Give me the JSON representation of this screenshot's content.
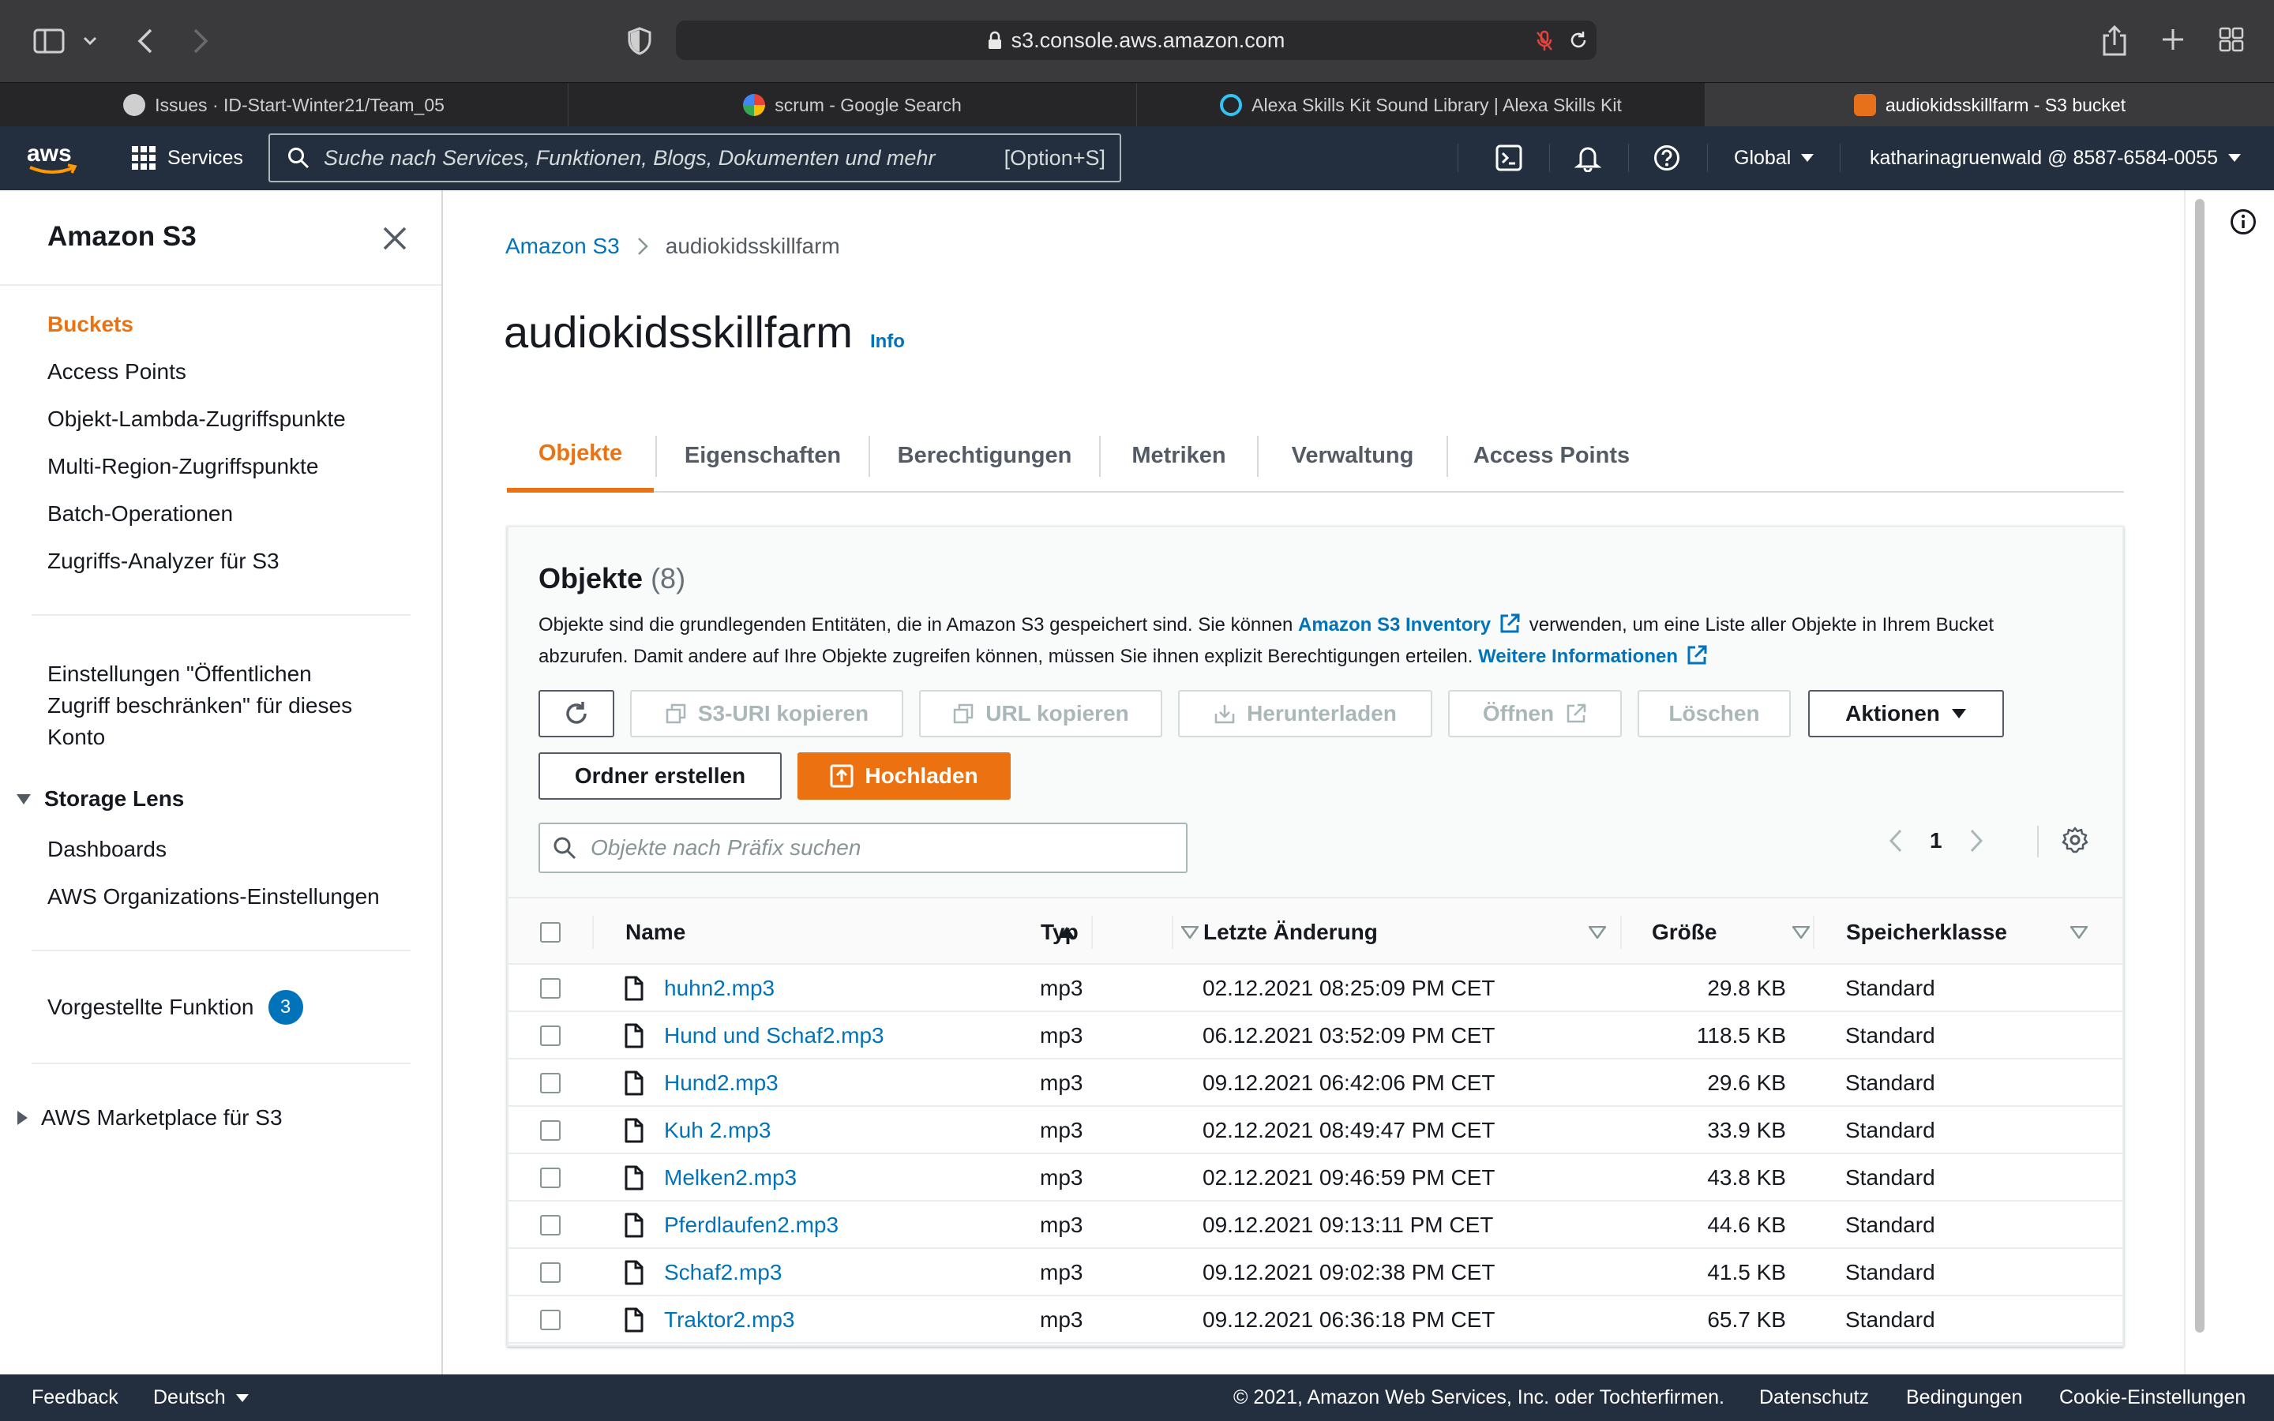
{
  "browser": {
    "url": "s3.console.aws.amazon.com",
    "tabs": [
      {
        "label": "Issues · ID-Start-Winter21/Team_05",
        "favicon": "github-icon"
      },
      {
        "label": "scrum - Google Search",
        "favicon": "google-icon"
      },
      {
        "label": "Alexa Skills Kit Sound Library | Alexa Skills Kit",
        "favicon": "alexa-icon"
      },
      {
        "label": "audiokidsskillfarm - S3 bucket",
        "favicon": "aws-s3-icon"
      }
    ]
  },
  "aws_nav": {
    "logo_text": "aws",
    "services_label": "Services",
    "search_placeholder": "Suche nach Services, Funktionen, Blogs, Dokumenten und mehr",
    "search_shortcut": "[Option+S]",
    "region": "Global",
    "account": "katharinagruenwald @ 8587-6584-0055"
  },
  "sidebar": {
    "title": "Amazon S3",
    "items": [
      {
        "label": "Buckets"
      },
      {
        "label": "Access Points"
      },
      {
        "label": "Objekt-Lambda-Zugriffspunkte"
      },
      {
        "label": "Multi-Region-Zugriffspunkte"
      },
      {
        "label": "Batch-Operationen"
      },
      {
        "label": "Zugriffs-Analyzer für S3"
      }
    ],
    "block_public_line1": "Einstellungen \"Öffentlichen",
    "block_public_line2": "Zugriff beschränken\" für dieses",
    "block_public_line3": "Konto",
    "storage_lens_heading": "Storage Lens",
    "storage_lens_items": [
      {
        "label": "Dashboards"
      },
      {
        "label": "AWS Organizations-Einstellungen"
      }
    ],
    "featured_label": "Vorgestellte Funktion",
    "featured_count": "3",
    "marketplace_label": "AWS Marketplace für S3"
  },
  "breadcrumb": {
    "root": "Amazon S3",
    "current": "audiokidsskillfarm"
  },
  "page": {
    "title": "audiokidsskillfarm",
    "info_label": "Info"
  },
  "tabs": [
    {
      "label": "Objekte"
    },
    {
      "label": "Eigenschaften"
    },
    {
      "label": "Berechtigungen"
    },
    {
      "label": "Metriken"
    },
    {
      "label": "Verwaltung"
    },
    {
      "label": "Access Points"
    }
  ],
  "objects_panel": {
    "title": "Objekte",
    "count": "(8)",
    "desc_part1": "Objekte sind die grundlegenden Entitäten, die in Amazon S3 gespeichert sind. Sie können ",
    "desc_link1": "Amazon S3 Inventory",
    "desc_part2": " verwenden, um eine Liste aller Objekte in Ihrem Bucket abzurufen. Damit andere auf Ihre Objekte zugreifen können, müssen Sie ihnen explizit Berechtigungen erteilen. ",
    "desc_link2": "Weitere Informationen",
    "buttons": {
      "copy_s3_uri": "S3-URI kopieren",
      "copy_url": "URL kopieren",
      "download": "Herunterladen",
      "open": "Öffnen",
      "delete": "Löschen",
      "actions": "Aktionen",
      "create_folder": "Ordner erstellen",
      "upload": "Hochladen"
    },
    "search_placeholder": "Objekte nach Präfix suchen",
    "page_number": "1"
  },
  "table": {
    "columns": [
      "Name",
      "Typ",
      "Letzte Änderung",
      "Größe",
      "Speicherklasse"
    ],
    "rows": [
      {
        "name": "huhn2.mp3",
        "type": "mp3",
        "modified": "02.12.2021 08:25:09 PM CET",
        "size": "29.8 KB",
        "class": "Standard"
      },
      {
        "name": "Hund und Schaf2.mp3",
        "type": "mp3",
        "modified": "06.12.2021 03:52:09 PM CET",
        "size": "118.5 KB",
        "class": "Standard"
      },
      {
        "name": "Hund2.mp3",
        "type": "mp3",
        "modified": "09.12.2021 06:42:06 PM CET",
        "size": "29.6 KB",
        "class": "Standard"
      },
      {
        "name": "Kuh 2.mp3",
        "type": "mp3",
        "modified": "02.12.2021 08:49:47 PM CET",
        "size": "33.9 KB",
        "class": "Standard"
      },
      {
        "name": "Melken2.mp3",
        "type": "mp3",
        "modified": "02.12.2021 09:46:59 PM CET",
        "size": "43.8 KB",
        "class": "Standard"
      },
      {
        "name": "Pferdlaufen2.mp3",
        "type": "mp3",
        "modified": "09.12.2021 09:13:11 PM CET",
        "size": "44.6 KB",
        "class": "Standard"
      },
      {
        "name": "Schaf2.mp3",
        "type": "mp3",
        "modified": "09.12.2021 09:02:38 PM CET",
        "size": "41.5 KB",
        "class": "Standard"
      },
      {
        "name": "Traktor2.mp3",
        "type": "mp3",
        "modified": "09.12.2021 06:36:18 PM CET",
        "size": "65.7 KB",
        "class": "Standard"
      }
    ]
  },
  "footer": {
    "feedback": "Feedback",
    "language": "Deutsch",
    "copyright": "© 2021, Amazon Web Services, Inc. oder Tochterfirmen.",
    "privacy": "Datenschutz",
    "terms": "Bedingungen",
    "cookies": "Cookie-Einstellungen"
  },
  "colors": {
    "aws_nav_bg": "#232f3e",
    "accent_orange": "#ec7211",
    "link_blue": "#0073bb",
    "text_dark": "#16191f"
  }
}
